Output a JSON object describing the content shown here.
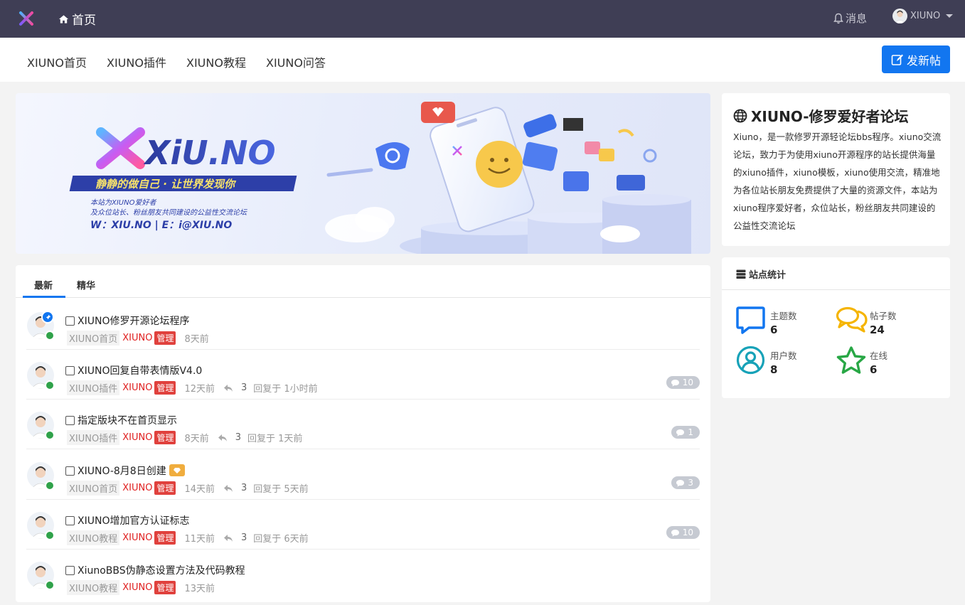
{
  "topbar": {
    "home_label": "首页",
    "messages_label": "消息",
    "username": "XIUNO"
  },
  "subnav": {
    "items": [
      "XIUNO首页",
      "XIUNO插件",
      "XIUNO教程",
      "XIUNO问答"
    ],
    "new_post_label": "发新帖"
  },
  "banner": {
    "logo_text": "XiU.NO",
    "slogan": "静静的做自己 · 让世界发现你",
    "line1": "本站为XIUNO爱好者",
    "line2": "及众位站长、粉丝朋友共同建设的公益性交流论坛",
    "line3": "W：XIU.NO | E：i@XIU.NO"
  },
  "tabs": [
    "最新",
    "精华"
  ],
  "threads": [
    {
      "title": "XIUNO修罗开源论坛程序",
      "forum": "XIUNO首页",
      "author": "XIUNO",
      "role": "管理",
      "time": "8天前",
      "pinned": true
    },
    {
      "title": "XIUNO回复自带表情版V4.0",
      "forum": "XIUNO插件",
      "author": "XIUNO",
      "role": "管理",
      "time": "12天前",
      "replies": "3",
      "last_reply": "回复于 1小时前",
      "reply_badge": "10"
    },
    {
      "title": "指定版块不在首页显示",
      "forum": "XIUNO插件",
      "author": "XIUNO",
      "role": "管理",
      "time": "8天前",
      "replies": "3",
      "last_reply": "回复于 1天前",
      "reply_badge": "1"
    },
    {
      "title": "XIUNO-8月8日创建",
      "forum": "XIUNO首页",
      "author": "XIUNO",
      "role": "管理",
      "time": "14天前",
      "replies": "3",
      "last_reply": "回复于 5天前",
      "reply_badge": "3",
      "gem": true
    },
    {
      "title": "XIUNO增加官方认证标志",
      "forum": "XIUNO教程",
      "author": "XIUNO",
      "role": "管理",
      "time": "11天前",
      "replies": "3",
      "last_reply": "回复于 6天前",
      "reply_badge": "10"
    },
    {
      "title": "XiunoBBS伪静态设置方法及代码教程",
      "forum": "XIUNO教程",
      "author": "XIUNO",
      "role": "管理",
      "time": "13天前"
    }
  ],
  "about": {
    "title": "XIUNO-修罗爱好者论坛",
    "text": "Xiuno，是一款修罗开源轻论坛bbs程序。xiuno交流论坛，致力于为使用xiuno开源程序的站长提供海量的xiuno插件，xiuno模板，xiuno使用交流，精准地为各位站长朋友免费提供了大量的资源文件，本站为xiuno程序爱好者，众位站长，粉丝朋友共同建设的公益性交流论坛"
  },
  "stats": {
    "title": "站点统计",
    "topics_label": "主题数",
    "topics": "6",
    "posts_label": "帖子数",
    "posts": "24",
    "users_label": "用户数",
    "users": "8",
    "online_label": "在线",
    "online": "6"
  },
  "colors": {
    "topbar": "#3f3e55",
    "primary": "#1276f0",
    "admin_tag": "#e0413d",
    "online": "#2fa24a",
    "stat_topics": "#1276f0",
    "stat_posts": "#f5b400",
    "stat_users": "#17a2b8",
    "stat_online": "#28a745"
  }
}
